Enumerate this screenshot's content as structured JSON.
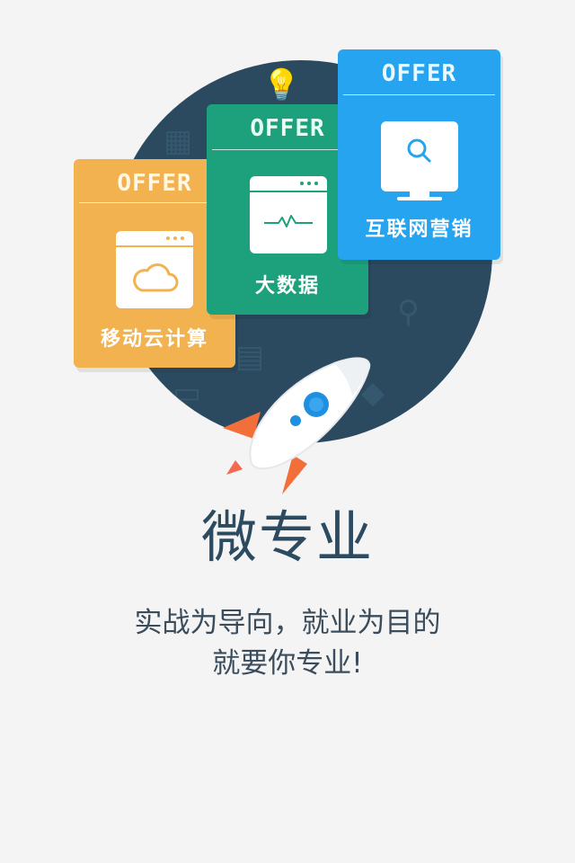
{
  "intro": {
    "title": "微专业",
    "subtitle_line1": "实战为导向，就业为目的",
    "subtitle_line2": "就要你专业!"
  },
  "cards": [
    {
      "badge": "OFFER",
      "label": "移动云计算",
      "icon": "cloud-icon",
      "color": "#f2b24f"
    },
    {
      "badge": "OFFER",
      "label": "大数据",
      "icon": "chart-pulse-icon",
      "color": "#1da17c"
    },
    {
      "badge": "OFFER",
      "label": "互联网营销",
      "icon": "monitor-search-icon",
      "color": "#27a4ef"
    }
  ],
  "decor": {
    "rocket": "rocket-icon",
    "circle_color": "#2b4a60"
  }
}
